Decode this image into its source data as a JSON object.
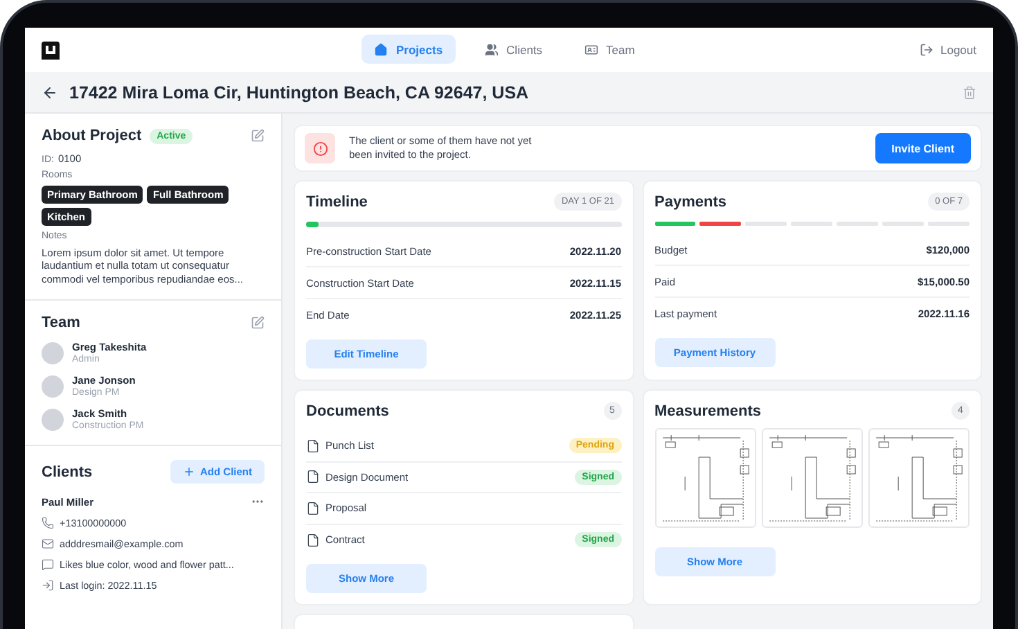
{
  "nav": {
    "tabs": [
      {
        "label": "Projects",
        "selected": true,
        "kind": "home"
      },
      {
        "label": "Clients",
        "selected": false,
        "kind": "people"
      },
      {
        "label": "Team",
        "selected": false,
        "kind": "badge"
      }
    ],
    "logout": "Logout"
  },
  "title": "17422 Mira Loma Cir, Huntington Beach, CA 92647, USA",
  "about": {
    "heading": "About Project",
    "status": "Active",
    "id_label": "ID:",
    "id": "0100",
    "rooms_label": "Rooms",
    "rooms": [
      "Primary Bathroom",
      "Full Bathroom",
      "Kitchen"
    ],
    "notes_label": "Notes",
    "notes": "Lorem ipsum dolor sit amet. Ut tempore laudantium et nulla totam ut consequatur commodi vel temporibus repudiandae eos..."
  },
  "team": {
    "heading": "Team",
    "members": [
      {
        "name": "Greg Takeshita",
        "role": "Admin"
      },
      {
        "name": "Jane Jonson",
        "role": "Design PM"
      },
      {
        "name": "Jack Smith",
        "role": "Construction PM"
      }
    ]
  },
  "clients": {
    "heading": "Clients",
    "add": "Add Client",
    "client": {
      "name": "Paul Miller",
      "details": [
        {
          "kind": "phone",
          "text": "+13100000000"
        },
        {
          "kind": "mail",
          "text": "adddresmail@example.com"
        },
        {
          "kind": "note",
          "text": "Likes blue color, wood and flower patt..."
        },
        {
          "kind": "login",
          "text": "Last login: 2022.11.15"
        }
      ]
    }
  },
  "alert": {
    "message": "The client or some of them have not yet been invited to the project.",
    "button": "Invite Client"
  },
  "timeline": {
    "heading": "Timeline",
    "badge": "DAY 1 OF 21",
    "level": 0.04,
    "rows": [
      {
        "label": "Pre-construction Start Date",
        "value": "2022.11.20"
      },
      {
        "label": "Construction Start Date",
        "value": "2022.11.15"
      },
      {
        "label": "End Date",
        "value": "2022.11.25"
      }
    ],
    "button": "Edit Timeline"
  },
  "payments": {
    "heading": "Payments",
    "badge": "0 OF 7",
    "segments": [
      {
        "color": "#22c55e"
      },
      {
        "color": "#ef4444"
      },
      {
        "color": "#e5e7eb"
      },
      {
        "color": "#e5e7eb"
      },
      {
        "color": "#e5e7eb"
      },
      {
        "color": "#e5e7eb"
      },
      {
        "color": "#e5e7eb"
      }
    ],
    "rows": [
      {
        "label": "Budget",
        "value": "$120,000"
      },
      {
        "label": "Paid",
        "value": "$15,000.50"
      },
      {
        "label": "Last payment",
        "value": "2022.11.16"
      }
    ],
    "button": "Payment History"
  },
  "documents": {
    "heading": "Documents",
    "count": "5",
    "items": [
      {
        "name": "Punch List",
        "status": "Pending",
        "kind": "pending"
      },
      {
        "name": "Design Document",
        "status": "Signed",
        "kind": "signed"
      },
      {
        "name": "Proposal",
        "kind": "none"
      },
      {
        "name": "Contract",
        "status": "Signed",
        "kind": "signed"
      }
    ],
    "button": "Show More"
  },
  "measurements": {
    "heading": "Measurements",
    "count": "4",
    "drawings": [
      {
        "kind": "floor-plan"
      },
      {
        "kind": "floor-plan"
      },
      {
        "kind": "floor-plan"
      }
    ],
    "button": "Show More"
  }
}
